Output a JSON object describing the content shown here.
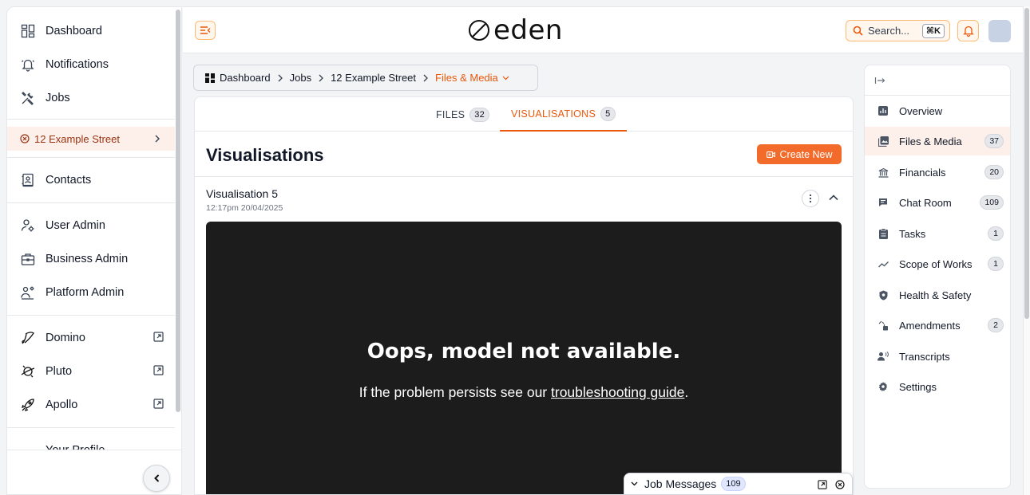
{
  "sidebar": {
    "items": [
      {
        "label": "Dashboard"
      },
      {
        "label": "Notifications"
      },
      {
        "label": "Jobs"
      },
      {
        "label": "12 Example Street"
      },
      {
        "label": "Contacts"
      },
      {
        "label": "User Admin"
      },
      {
        "label": "Business Admin"
      },
      {
        "label": "Platform Admin"
      },
      {
        "label": "Domino"
      },
      {
        "label": "Pluto"
      },
      {
        "label": "Apollo"
      },
      {
        "label": "Your Profile"
      }
    ]
  },
  "topbar": {
    "logo_text": "eden",
    "search_label": "Search...",
    "search_shortcut": "⌘K"
  },
  "breadcrumb": {
    "items": [
      "Dashboard",
      "Jobs",
      "12 Example Street",
      "Files & Media"
    ]
  },
  "tabs": [
    {
      "label": "FILES",
      "count": "32"
    },
    {
      "label": "VISUALISATIONS",
      "count": "5"
    }
  ],
  "main": {
    "title": "Visualisations",
    "create_label": "Create New",
    "visualisation": {
      "title": "Visualisation 5",
      "timestamp": "12:17pm 20/04/2025"
    },
    "error": {
      "title": "Oops, model not available.",
      "message_prefix": "If the problem persists see our ",
      "link_text": "troubleshooting guide",
      "message_suffix": "."
    }
  },
  "job_messages": {
    "label": "Job Messages",
    "count": "109"
  },
  "right_nav": {
    "items": [
      {
        "label": "Overview",
        "count": null
      },
      {
        "label": "Files & Media",
        "count": "37"
      },
      {
        "label": "Financials",
        "count": "20"
      },
      {
        "label": "Chat Room",
        "count": "109"
      },
      {
        "label": "Tasks",
        "count": "1"
      },
      {
        "label": "Scope of Works",
        "count": "1"
      },
      {
        "label": "Health & Safety",
        "count": null
      },
      {
        "label": "Amendments",
        "count": "2"
      },
      {
        "label": "Transcripts",
        "count": null
      },
      {
        "label": "Settings",
        "count": null
      }
    ]
  },
  "colors": {
    "accent": "#ea580c",
    "accent_button": "#f26b2a",
    "active_bg": "#fdf0ea",
    "viewer_bg": "#1c1c1c"
  }
}
